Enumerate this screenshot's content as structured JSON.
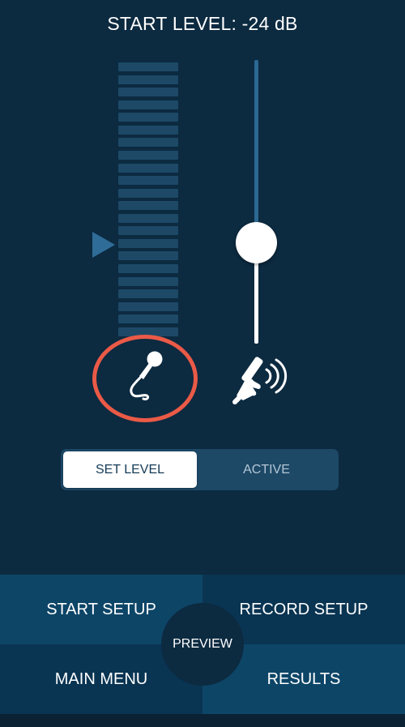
{
  "header": {
    "title": "START LEVEL: -24 dB"
  },
  "level_meter": {
    "segments": 22,
    "lit_segments": 0,
    "marker": "level-marker"
  },
  "gain_slider": {
    "level": 0.36
  },
  "input_sources": {
    "microphone_icon": "microphone-icon",
    "remote_icon": "remote-control-icon",
    "selected": "microphone"
  },
  "mode_toggle": {
    "options": [
      "SET LEVEL",
      "ACTIVE"
    ],
    "selected": "SET LEVEL"
  },
  "bottom_nav": {
    "start_setup": "START SETUP",
    "record_setup": "RECORD SETUP",
    "main_menu": "MAIN MENU",
    "results": "RESULTS",
    "preview": "PREVIEW"
  },
  "colors": {
    "background": "#0c2a40",
    "meter_segment": "#1d4967",
    "accent_blue": "#2b6892",
    "highlight_ring": "#ea5a47",
    "nav_light": "#0d4567",
    "nav_dark": "#093452"
  }
}
